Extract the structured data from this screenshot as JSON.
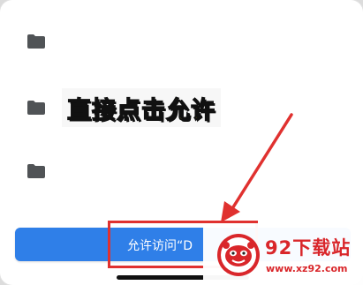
{
  "dialog": {
    "folders": [
      {
        "icon": "folder-icon"
      },
      {
        "icon": "folder-icon"
      },
      {
        "icon": "folder-icon"
      }
    ],
    "allow_button_label": "允许访问“D"
  },
  "annotation": {
    "caption": "直接点击允许",
    "caption_color": "#ffec1a",
    "highlight_color": "#e0312f",
    "arrow_color": "#e0312f"
  },
  "watermark": {
    "title": "92下载站",
    "url": "www.xz92.com",
    "brand_color": "#d9262a"
  },
  "colors": {
    "button": "#2f7fe8",
    "folder": "#505356"
  }
}
